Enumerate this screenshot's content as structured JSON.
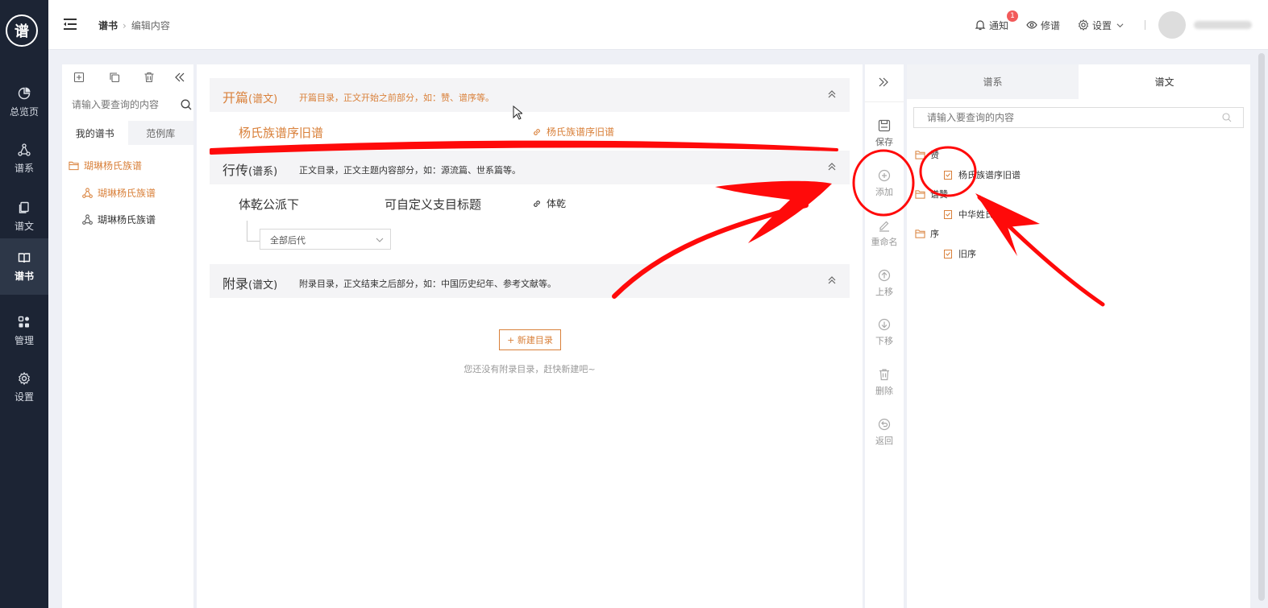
{
  "nav": {
    "logo_text": "谱",
    "items": [
      {
        "label": "总览页",
        "icon": "pie-chart-icon"
      },
      {
        "label": "谱系",
        "icon": "tree-network-icon"
      },
      {
        "label": "谱文",
        "icon": "document-copy-icon"
      },
      {
        "label": "谱书",
        "icon": "book-icon"
      },
      {
        "label": "管理",
        "icon": "grid-icon"
      },
      {
        "label": "设置",
        "icon": "gear-icon"
      }
    ],
    "active": "谱书"
  },
  "topbar": {
    "breadcrumb": [
      "谱书",
      "编辑内容"
    ],
    "notify_label": "通知",
    "notify_count": "1",
    "revise_label": "修谱",
    "settings_label": "设置"
  },
  "left_panel": {
    "search_placeholder": "请输入要查询的内容",
    "tabs": [
      "我的谱书",
      "范例库"
    ],
    "tree_root": "瑚琳杨氏族谱",
    "tree_children": [
      "瑚琳杨氏族谱",
      "瑚琳杨氏族谱"
    ]
  },
  "center": {
    "sections": [
      {
        "title": "开篇",
        "sub": "(谱文)",
        "desc": "开篇目录，正文开始之前部分，如：赞、谱序等。"
      },
      {
        "title": "行传",
        "sub": "(谱系)",
        "desc": "正文目录，正文主题内容部分，如：源流篇、世系篇等。"
      },
      {
        "title": "附录",
        "sub": "(谱文)",
        "desc": "附录目录，正文结束之后部分，如：中国历史纪年、参考文献等。"
      }
    ],
    "entry1_title": "杨氏族谱序旧谱",
    "entry1_link": "杨氏族谱序旧谱",
    "entry2_title": "体乾公派下",
    "entry2_subtitle": "可自定义支目标题",
    "entry2_link": "体乾",
    "select_value": "全部后代",
    "new_button": "+ 新建目录",
    "empty_text": "您还没有附录目录，赶快新建吧~"
  },
  "toolbar": {
    "buttons": [
      {
        "label": "保存",
        "icon": "save-icon"
      },
      {
        "label": "添加",
        "icon": "add-circle-icon"
      },
      {
        "label": "重命名",
        "icon": "edit-icon"
      },
      {
        "label": "上移",
        "icon": "arrow-up-circle-icon"
      },
      {
        "label": "下移",
        "icon": "arrow-down-circle-icon"
      },
      {
        "label": "删除",
        "icon": "trash-icon"
      },
      {
        "label": "返回",
        "icon": "undo-icon"
      }
    ]
  },
  "right_panel": {
    "tabs": [
      "谱系",
      "谱文"
    ],
    "active_tab": "谱文",
    "search_placeholder": "请输入要查询的内容",
    "tree": [
      {
        "folder": "赞",
        "files": [
          "杨氏族谱序旧谱"
        ]
      },
      {
        "folder": "谱赞",
        "files": [
          "中华姓氏"
        ]
      },
      {
        "folder": "序",
        "files": [
          "旧序"
        ]
      }
    ]
  },
  "colors": {
    "accent": "#d9803a",
    "nav_bg": "#1c2434",
    "annotation_red": "#ff0a0a"
  }
}
